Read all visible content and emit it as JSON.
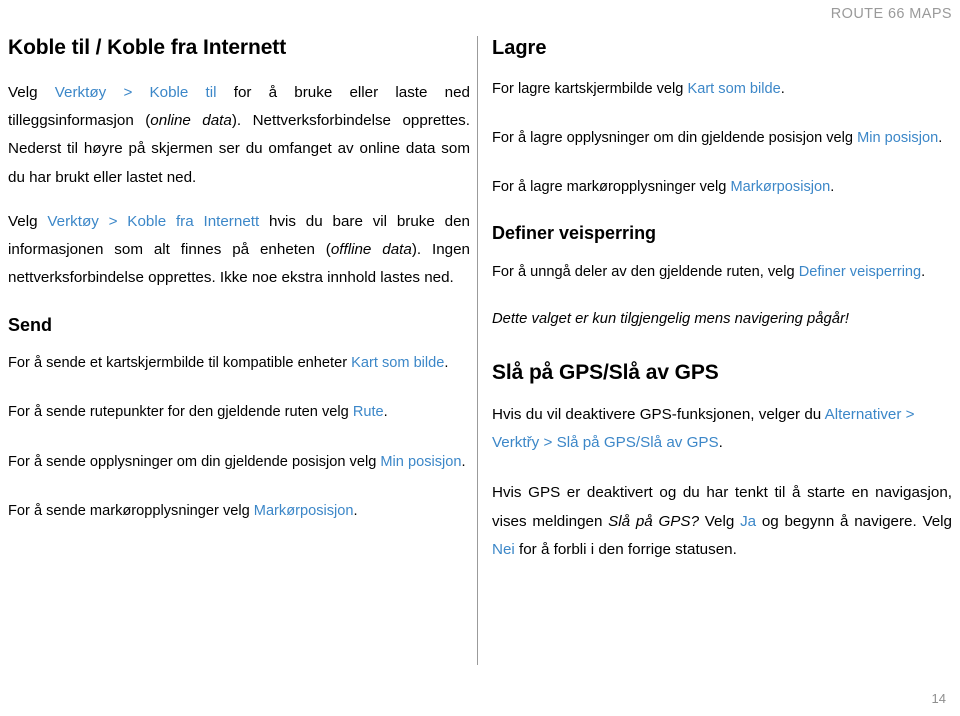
{
  "header": {
    "running_head_first": "R",
    "running_head_rest": "OUTE",
    "running_head_number": " 66 ",
    "running_head_maps_first": "M",
    "running_head_maps_rest": "APS",
    "running_head_full": "ROUTE 66 MAPS"
  },
  "left_column": {
    "title": "Koble til / Koble fra Internett",
    "p1": {
      "a": "Velg ",
      "link1": "Verktøy > Koble til",
      "b": " for å bruke eller laste ned tilleggsinformasjon (",
      "italic1": "online data",
      "c": "). Nettverksforbindelse opprettes. Nederst til høyre på skjermen ser du omfanget av online data som du har brukt eller lastet ned."
    },
    "p2": {
      "a": "Velg ",
      "link1": "Verktøy > Koble fra Internett",
      "b": " hvis du bare vil bruke den informasjonen som alt finnes på enheten (",
      "italic1": "offline data",
      "c": "). Ingen nettverksforbindelse opprettes. Ikke noe ekstra innhold lastes ned."
    },
    "send_heading": "Send",
    "p3": {
      "a": "For å sende et kartskjermbilde til kompatible enheter ",
      "link1": "Kart som bilde",
      "b": "."
    },
    "p4": {
      "a": "For å sende rutepunkter for den gjeldende ruten velg ",
      "link1": "Rute",
      "b": "."
    },
    "p5": {
      "a": "For å sende opplysninger om din gjeldende posisjon velg ",
      "link1": "Min posisjon",
      "b": "."
    },
    "p6": {
      "a": "For å sende markøropplysninger velg ",
      "link1": "Markørposisjon",
      "b": "."
    }
  },
  "right_column": {
    "lagre_heading": "Lagre",
    "p1": {
      "a": "For lagre kartskjermbilde velg ",
      "link1": "Kart som bilde",
      "b": "."
    },
    "p2": {
      "a": "For å lagre opplysninger om din gjeldende posisjon velg ",
      "link1": "Min posisjon",
      "b": "."
    },
    "p3": {
      "a": "For å lagre markøropplysninger velg ",
      "link1": "Markørposisjon",
      "b": "."
    },
    "veisperring_heading": "Definer veisperring",
    "p4": {
      "a": "For å unngå deler av den gjeldende ruten, velg ",
      "link1": "Definer veisperring",
      "b": "."
    },
    "note": "Dette valget er kun tilgjengelig mens navigering pågår!",
    "gps_heading": "Slå på GPS/Slå av GPS",
    "p5": {
      "a": "Hvis du vil deaktivere GPS-funksjonen, velger du ",
      "link1": "Alternativer > Verktřy > Slå på GPS/Slå av GPS",
      "b": "."
    },
    "p6": {
      "a": "Hvis GPS er deaktivert og du har tenkt til å starte en navigasjon, vises meldingen ",
      "italic1": "Slå på GPS?",
      "b": " Velg ",
      "link1": "Ja",
      "c": " og begynn å navigere. Velg ",
      "link2": "Nei",
      "d": " for å forbli i den forrige statusen."
    }
  },
  "footer": {
    "page_number": "14"
  },
  "colors": {
    "link": "#3c87c8",
    "header_gray": "#9a9a9a",
    "divider": "#9b9b9b"
  }
}
